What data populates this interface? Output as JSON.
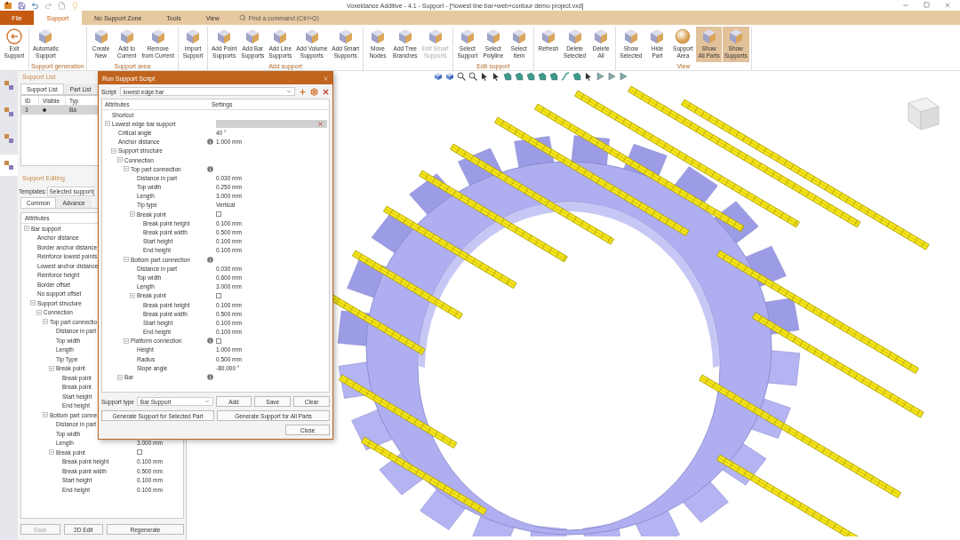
{
  "window": {
    "title": "Voxeldance Additive - 4.1 - Support - [*lowest line bar+web+contour demo project.vxd]"
  },
  "menu_tabs": [
    {
      "label": "File",
      "kind": "file",
      "selected": false
    },
    {
      "label": "Support",
      "kind": "tab",
      "selected": true
    },
    {
      "label": "No Support Zone",
      "kind": "tab",
      "selected": false
    },
    {
      "label": "Tools",
      "kind": "tab",
      "selected": false
    },
    {
      "label": "View",
      "kind": "tab",
      "selected": false
    }
  ],
  "search": {
    "placeholder": "Find a command (Ctrl+Q)"
  },
  "ribbon": [
    {
      "buttons": [
        {
          "lines": [
            "Exit",
            "Support"
          ],
          "kind": "exit",
          "on": false,
          "disabled": false
        }
      ]
    },
    {
      "label": "Support generation",
      "buttons": [
        {
          "lines": [
            "Automatic",
            "Support"
          ],
          "kind": "cube",
          "on": false,
          "disabled": false
        }
      ]
    },
    {
      "label": "Support area",
      "buttons": [
        {
          "lines": [
            "Create",
            "New"
          ],
          "kind": "cube",
          "on": false,
          "disabled": false
        },
        {
          "lines": [
            "Add to",
            "Current"
          ],
          "kind": "cube",
          "on": false,
          "disabled": false
        },
        {
          "lines": [
            "Remove",
            "from Current"
          ],
          "kind": "cube",
          "on": false,
          "disabled": false
        }
      ]
    },
    {
      "buttons": [
        {
          "lines": [
            "Import",
            "Support"
          ],
          "kind": "cube",
          "on": false,
          "disabled": false
        }
      ]
    },
    {
      "label": "Add support",
      "buttons": [
        {
          "lines": [
            "Add Point",
            "Supports"
          ],
          "kind": "cube",
          "on": false,
          "disabled": false
        },
        {
          "lines": [
            "Add Bar",
            "Supports"
          ],
          "kind": "cube",
          "on": false,
          "disabled": false
        },
        {
          "lines": [
            "Add Line",
            "Supports"
          ],
          "kind": "cube",
          "on": false,
          "disabled": false
        },
        {
          "lines": [
            "Add Volume",
            "Supports"
          ],
          "kind": "cube",
          "on": false,
          "disabled": false
        },
        {
          "lines": [
            "Add Smart",
            "Supports"
          ],
          "kind": "cube",
          "on": false,
          "disabled": false
        }
      ]
    },
    {
      "buttons": [
        {
          "lines": [
            "Move",
            "Nodes"
          ],
          "kind": "cube",
          "on": false,
          "disabled": false
        },
        {
          "lines": [
            "Add Tree",
            "Branches"
          ],
          "kind": "cube",
          "on": false,
          "disabled": false
        },
        {
          "lines": [
            "Edit Smart",
            "Supports"
          ],
          "kind": "cube",
          "on": false,
          "disabled": true
        }
      ]
    },
    {
      "label": "Edit support",
      "buttons": [
        {
          "lines": [
            "Select",
            "Support"
          ],
          "kind": "cube",
          "on": false,
          "disabled": false
        },
        {
          "lines": [
            "Select",
            "Polyline"
          ],
          "kind": "cube",
          "on": false,
          "disabled": false
        },
        {
          "lines": [
            "Select",
            "Item"
          ],
          "kind": "cube",
          "on": false,
          "disabled": false
        }
      ]
    },
    {
      "buttons": [
        {
          "lines": [
            "Refresh"
          ],
          "kind": "cube",
          "on": false,
          "disabled": false
        },
        {
          "lines": [
            "Delete",
            "Selected"
          ],
          "kind": "cube",
          "on": false,
          "disabled": false
        },
        {
          "lines": [
            "Delete",
            "All"
          ],
          "kind": "cube",
          "on": false,
          "disabled": false
        }
      ]
    },
    {
      "label": "View",
      "buttons": [
        {
          "lines": [
            "Show",
            "Selected"
          ],
          "kind": "cube",
          "on": false,
          "disabled": false
        },
        {
          "lines": [
            "Hide",
            "Part"
          ],
          "kind": "cube",
          "on": false,
          "disabled": false
        },
        {
          "lines": [
            "Support",
            "Area"
          ],
          "kind": "sphere",
          "on": false,
          "disabled": false
        },
        {
          "lines": [
            "Show",
            "All Parts"
          ],
          "kind": "cube",
          "on": true,
          "disabled": false
        },
        {
          "lines": [
            "Show",
            "Supports"
          ],
          "kind": "cube",
          "on": true,
          "disabled": false
        }
      ]
    }
  ],
  "side_icons": [
    {
      "selected": false
    },
    {
      "selected": false
    },
    {
      "selected": false
    },
    {
      "selected": true
    }
  ],
  "support_list": {
    "title": "Support List",
    "tabs": [
      {
        "label": "Support List",
        "selected": true
      },
      {
        "label": "Part List",
        "selected": false
      }
    ],
    "columns": [
      "ID",
      "Visible",
      "Typ"
    ],
    "rows": [
      {
        "id": "3",
        "visible": true,
        "type": "Ba",
        "selected": true
      }
    ]
  },
  "support_editing": {
    "title": "Support Editing",
    "templates_label": "Templates:",
    "template": "Selected support(",
    "tabs": [
      {
        "label": "Common",
        "selected": true
      },
      {
        "label": "Advance",
        "selected": false
      }
    ],
    "attributes_header": "Attributes",
    "tree": [
      {
        "label": "Bar support",
        "expanded": true,
        "children": [
          {
            "label": "Anchor distance"
          },
          {
            "label": "Border anchor distance"
          },
          {
            "label": "Reinforce lowest points"
          },
          {
            "label": "Lowest anchor distance"
          },
          {
            "label": "Reinforce height"
          },
          {
            "label": "Border offset"
          },
          {
            "label": "No support offset"
          },
          {
            "label": "Support structure",
            "expanded": true,
            "children": [
              {
                "label": "Connection",
                "expanded": true,
                "children": [
                  {
                    "label": "Top part connectio",
                    "expanded": true,
                    "children": [
                      {
                        "label": "Distance in part"
                      },
                      {
                        "label": "Top width"
                      },
                      {
                        "label": "Length"
                      },
                      {
                        "label": "Tip Type"
                      },
                      {
                        "label": "Break point",
                        "expanded": true,
                        "children": [
                          {
                            "label": "Break point"
                          },
                          {
                            "label": "Break point"
                          },
                          {
                            "label": "Start height"
                          },
                          {
                            "label": "End height"
                          }
                        ]
                      }
                    ]
                  },
                  {
                    "label": "Bottom part conne",
                    "expanded": true,
                    "children": [
                      {
                        "label": "Distance in part"
                      },
                      {
                        "label": "Top width"
                      },
                      {
                        "label": "Length",
                        "value": "3.000 mm"
                      },
                      {
                        "label": "Break point",
                        "expanded": true,
                        "checked": false,
                        "children": [
                          {
                            "label": "Break point height",
                            "value": "0.100 mm"
                          },
                          {
                            "label": "Break point width",
                            "value": "0.500 mm"
                          },
                          {
                            "label": "Start height",
                            "value": "0.100 mm"
                          },
                          {
                            "label": "End height",
                            "value": "0.100 mm"
                          }
                        ]
                      }
                    ]
                  }
                ]
              }
            ]
          }
        ]
      }
    ],
    "buttons": [
      {
        "label": "Save",
        "disabled": true
      },
      {
        "label": "2D Edit",
        "disabled": false
      },
      {
        "label": "Regenerate",
        "disabled": false
      }
    ]
  },
  "dialog": {
    "title": "Run Support Script",
    "script_label": "Script",
    "script": "lowest edge bar",
    "columns": [
      "Attributes",
      "Settings"
    ],
    "tree": [
      {
        "label": "Shortcut"
      },
      {
        "label": "Lowest edge bar support",
        "expanded": true,
        "field": true,
        "children": [
          {
            "label": "Critical angle",
            "value": "40 °"
          },
          {
            "label": "Anchor distance",
            "info": true,
            "value": "1.000 mm"
          },
          {
            "label": "Support structure",
            "expanded": true,
            "children": [
              {
                "label": "Connection",
                "expanded": true,
                "children": [
                  {
                    "label": "Top part connection",
                    "expanded": true,
                    "info": true,
                    "children": [
                      {
                        "label": "Distance in part",
                        "value": "0.030 mm"
                      },
                      {
                        "label": "Top width",
                        "value": "0.250 mm"
                      },
                      {
                        "label": "Length",
                        "value": "3.000 mm"
                      },
                      {
                        "label": "Tip type",
                        "value": "Vertical"
                      },
                      {
                        "label": "Break point",
                        "expanded": true,
                        "checked": false,
                        "children": [
                          {
                            "label": "Break point height",
                            "value": "0.100 mm"
                          },
                          {
                            "label": "Break point width",
                            "value": "0.500 mm"
                          },
                          {
                            "label": "Start height",
                            "value": "0.100 mm"
                          },
                          {
                            "label": "End height",
                            "value": "0.100 mm"
                          }
                        ]
                      }
                    ]
                  },
                  {
                    "label": "Bottom part connection",
                    "expanded": true,
                    "info": true,
                    "children": [
                      {
                        "label": "Distance in part",
                        "value": "0.030 mm"
                      },
                      {
                        "label": "Top width",
                        "value": "0.600 mm"
                      },
                      {
                        "label": "Length",
                        "value": "3.000 mm"
                      },
                      {
                        "label": "Break point",
                        "expanded": true,
                        "checked": false,
                        "children": [
                          {
                            "label": "Break point height",
                            "value": "0.100 mm"
                          },
                          {
                            "label": "Break point width",
                            "value": "0.500 mm"
                          },
                          {
                            "label": "Start height",
                            "value": "0.100 mm"
                          },
                          {
                            "label": "End height",
                            "value": "0.100 mm"
                          }
                        ]
                      }
                    ]
                  },
                  {
                    "label": "Platform connection",
                    "expanded": true,
                    "info": true,
                    "checked": false,
                    "children": [
                      {
                        "label": "Height",
                        "value": "1.000 mm"
                      },
                      {
                        "label": "Radius",
                        "value": "0.500 mm"
                      },
                      {
                        "label": "Slope angle",
                        "value": "-80.000 °"
                      }
                    ]
                  }
                ]
              },
              {
                "label": "Bar",
                "expanded": true,
                "info": true
              }
            ]
          }
        ]
      }
    ],
    "support_type_label": "Support type",
    "support_type": "Bar Support",
    "buttons": [
      {
        "label": "Add"
      },
      {
        "label": "Save"
      },
      {
        "label": "Clear"
      }
    ],
    "generate_buttons": [
      {
        "label": "Generate Support for Selected Part"
      },
      {
        "label": "Generate Support for All Parts"
      }
    ],
    "close_label": "Close"
  }
}
